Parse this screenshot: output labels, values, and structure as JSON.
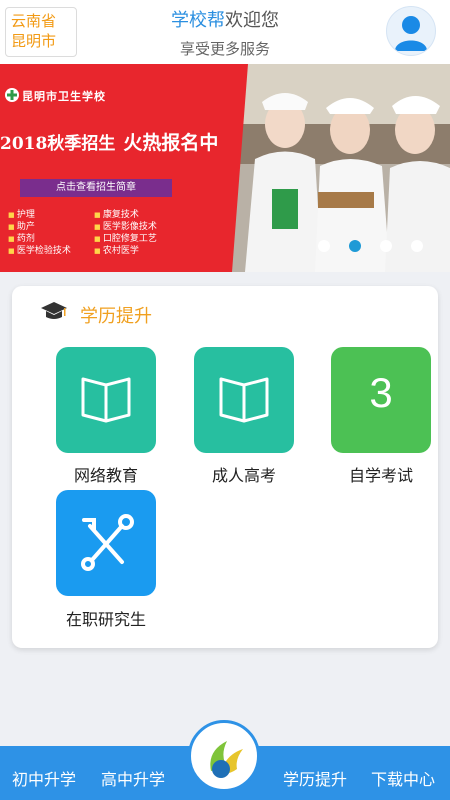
{
  "header": {
    "location_province": "云南省",
    "location_city": "昆明市",
    "brand": "学校帮",
    "welcome": "欢迎您",
    "subtitle": "享受更多服务",
    "avatar_icon": "user-avatar-icon"
  },
  "banner": {
    "school_name": "昆明市卫生学校",
    "enroll_text": "2018秋季招生",
    "enroll_hot": "火热报名中",
    "cta": "点击查看招生简章",
    "majors_left": [
      "护理",
      "助产",
      "药剂",
      "医学检验技术"
    ],
    "majors_right": [
      "康复技术",
      "医学影像技术",
      "口腔修复工艺",
      "农村医学"
    ],
    "slides_total": 4,
    "active_slide": 2,
    "colors": {
      "red": "#e8262d",
      "active_dot": "#1e9ad6"
    }
  },
  "section": {
    "title": "学历提升",
    "icon": "graduation-cap-icon",
    "items": [
      {
        "label": "网络教育",
        "icon": "book-icon",
        "color": "#27bfa0"
      },
      {
        "label": "成人高考",
        "icon": "book-icon",
        "color": "#27bfa0"
      },
      {
        "label": "自学考试",
        "icon": "number-3-icon",
        "glyph": "3",
        "color": "#4cc154"
      },
      {
        "label": "在职研究生",
        "icon": "tools-icon",
        "color": "#1a9bf0"
      }
    ]
  },
  "bottom_nav": {
    "items": [
      "初中升学",
      "高中升学",
      "学历提升",
      "下载中心"
    ],
    "center_icon": "app-logo-icon",
    "color": "#2e92e6"
  }
}
